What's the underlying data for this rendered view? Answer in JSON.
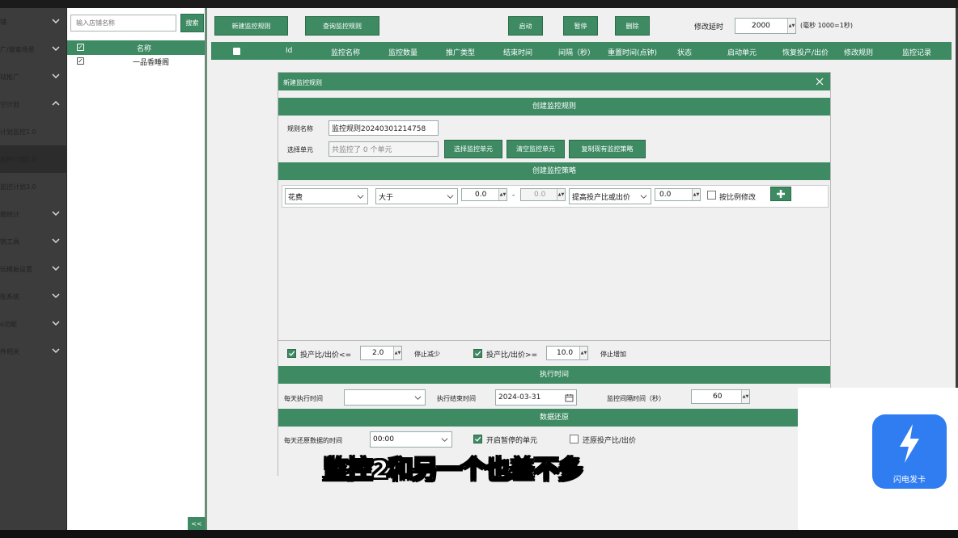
{
  "nav": {
    "items": [
      {
        "label": "铺",
        "has_chevron": true,
        "active": false
      },
      {
        "label": "广/搜索场景",
        "has_chevron": true,
        "active": false
      },
      {
        "label": "站推广",
        "has_chevron": true,
        "active": false
      },
      {
        "label": "空计划",
        "has_chevron": true,
        "expanded": true,
        "active": false
      },
      {
        "label": "计划监控1.0",
        "has_chevron": false,
        "active": false
      },
      {
        "label": "监控计划2.0",
        "has_chevron": false,
        "active": true
      },
      {
        "label": "监控计划3.0",
        "has_chevron": false,
        "active": false
      },
      {
        "label": "据统计",
        "has_chevron": true,
        "active": false
      },
      {
        "label": "销工具",
        "has_chevron": true,
        "active": false
      },
      {
        "label": "玩模板设置",
        "has_chevron": true,
        "active": false
      },
      {
        "label": "账系统",
        "has_chevron": true,
        "active": false
      },
      {
        "label": "o功能",
        "has_chevron": true,
        "active": false
      },
      {
        "label": "件相关",
        "has_chevron": true,
        "active": false
      }
    ]
  },
  "shop_panel": {
    "search_placeholder": "输入店铺名称",
    "search_button": "搜索",
    "column_name": "名称",
    "rows": [
      {
        "name": "一品香睡阁",
        "checked": true
      }
    ],
    "collapse_label": "<<"
  },
  "toolbar": {
    "new_rule": "新建监控规则",
    "query_rule": "查询监控规则",
    "start": "启动",
    "pause": "暂停",
    "delete": "删除",
    "delay_label": "修改延时",
    "delay_value": "2000",
    "delay_note": "(毫秒 1000=1秒)"
  },
  "grid": {
    "columns": [
      "Id",
      "监控名称",
      "监控数量",
      "推广类型",
      "结束时间",
      "间隔（秒）",
      "重置时间(点钟)",
      "状态",
      "启动单元",
      "恢复投产/出价",
      "修改规则",
      "监控记录"
    ]
  },
  "dialog": {
    "title": "新建监控规则",
    "section_create_rule": "创建监控规则",
    "rule_name_label": "规则名称",
    "rule_name_value": "监控规则20240301214758",
    "select_unit_label": "选择单元",
    "select_unit_value": "共监控了 0 个单元",
    "btn_select_unit": "选择监控单元",
    "btn_clear_unit": "清空监控单元",
    "btn_copy_strategy": "复制现有监控策略",
    "section_strategy": "创建监控策略",
    "strategy": {
      "metric": "花费",
      "operator": "大于",
      "value_min": "0.0",
      "dash": "-",
      "value_max": "0.0",
      "action": "提高投产比或出价",
      "action_value": "0.0",
      "proportional_label": "按比例修改",
      "add_icon": "plus-icon"
    },
    "roi_le_label": "投产比/出价<=",
    "roi_le_value": "2.0",
    "stop_reduce": "停止减少",
    "roi_ge_label": "投产比/出价>=",
    "roi_ge_value": "10.0",
    "stop_increase": "停止增加",
    "section_exec_time": "执行时间",
    "daily_exec_label": "每天执行时间",
    "daily_exec_value": "",
    "exec_end_label": "执行结束时间",
    "exec_end_value": "2024-03-31",
    "interval_label": "监控间隔时间（秒）",
    "interval_value": "60",
    "section_restore": "数据还原",
    "daily_restore_label": "每天还原数据的时间",
    "daily_restore_value": "00:00",
    "open_paused_label": "开启暂停的单元",
    "restore_roi_label": "还原投产比/出价"
  },
  "subtitle": "监控2和另一个也差不多",
  "watermark": {
    "text": "闪电发卡",
    "icon": "lightning-icon"
  },
  "colors": {
    "accent": "#3d8a63",
    "nav_bg": "#3c3c3c",
    "logo_blue": "#2f7df0"
  }
}
